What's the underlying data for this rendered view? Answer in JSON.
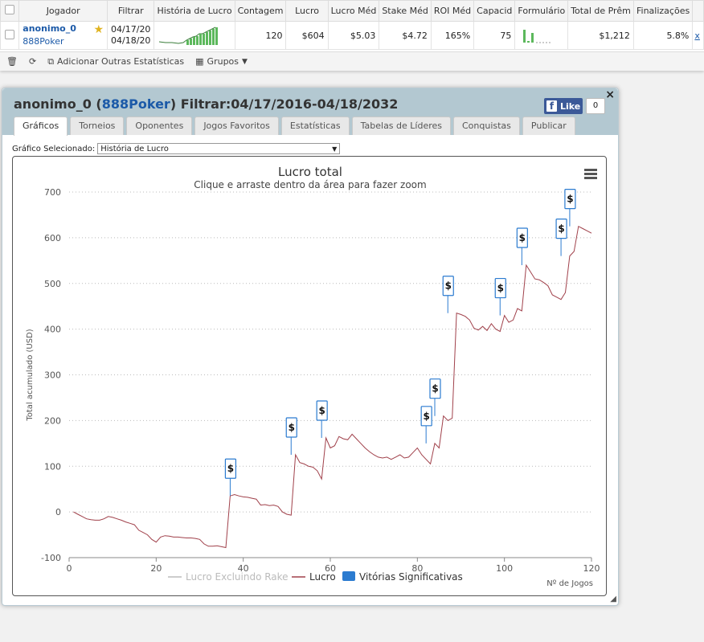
{
  "stats": {
    "columns": [
      "Jogador",
      "Filtrar",
      "História de Lucro",
      "Contagem",
      "Lucro",
      "Lucro Méd",
      "Stake Méd",
      "ROI Méd",
      "Capacid",
      "Formulário",
      "Total de Prêm",
      "Finalizações"
    ],
    "row": {
      "player": "anonimo_0",
      "site": "888Poker",
      "filter_from": "04/17/20",
      "filter_to": "04/18/20",
      "count": "120",
      "profit": "$604",
      "avg_profit": "$5.03",
      "avg_stake": "$4.72",
      "avg_roi": "165%",
      "ability": "75",
      "total_prizes": "$1,212",
      "finishes": "5.8%",
      "remove": "x"
    },
    "toolbar": {
      "add_stats": "Adicionar Outras Estatísticas",
      "groups": "Grupos"
    }
  },
  "panel": {
    "player": "anonimo_0",
    "site": "888Poker",
    "filter_label": "Filtrar:",
    "filter_range": "04/17/2016-04/18/2032",
    "fb_like": "Like",
    "fb_count": "0",
    "close": "×",
    "tabs": [
      "Gráficos",
      "Torneios",
      "Oponentes",
      "Jogos Favoritos",
      "Estatísticas",
      "Tabelas de Líderes",
      "Conquistas",
      "Publicar"
    ],
    "selected_label": "Gráfico Selecionado:",
    "selected_value": "História de Lucro"
  },
  "chart_data": {
    "type": "line",
    "title": "Lucro total",
    "subtitle": "Clique e arraste dentro da área para fazer zoom",
    "ylabel": "Total acumulado (USD)",
    "xlabel": "Nº de Jogos",
    "xlim": [
      0,
      120
    ],
    "ylim": [
      -100,
      700
    ],
    "xticks": [
      0,
      20,
      40,
      60,
      80,
      100,
      120
    ],
    "yticks": [
      -100,
      0,
      100,
      200,
      300,
      400,
      500,
      600,
      700
    ],
    "legend": [
      "Lucro Excluindo Rake",
      "Lucro",
      "Vitórias Significativas"
    ],
    "colors": {
      "line": "#a0404a",
      "rake": "#cccccc",
      "flag": "#2b7bd0"
    },
    "series": [
      {
        "name": "Lucro",
        "x": [
          1,
          2,
          3,
          4,
          5,
          6,
          7,
          8,
          9,
          10,
          11,
          12,
          13,
          14,
          15,
          16,
          17,
          18,
          19,
          20,
          21,
          22,
          23,
          24,
          25,
          26,
          27,
          28,
          29,
          30,
          31,
          32,
          33,
          34,
          35,
          36,
          37,
          38,
          39,
          40,
          41,
          42,
          43,
          44,
          45,
          46,
          47,
          48,
          49,
          50,
          51,
          52,
          53,
          54,
          55,
          56,
          57,
          58,
          59,
          60,
          61,
          62,
          63,
          64,
          65,
          66,
          67,
          68,
          69,
          70,
          71,
          72,
          73,
          74,
          75,
          76,
          77,
          78,
          79,
          80,
          81,
          82,
          83,
          84,
          85,
          86,
          87,
          88,
          89,
          90,
          91,
          92,
          93,
          94,
          95,
          96,
          97,
          98,
          99,
          100,
          101,
          102,
          103,
          104,
          105,
          106,
          107,
          108,
          109,
          110,
          111,
          112,
          113,
          114,
          115,
          116,
          117,
          118,
          119,
          120
        ],
        "values": [
          0,
          -5,
          -10,
          -15,
          -17,
          -18,
          -18,
          -15,
          -10,
          -12,
          -15,
          -18,
          -22,
          -25,
          -28,
          -40,
          -45,
          -50,
          -60,
          -66,
          -55,
          -52,
          -53,
          -55,
          -55,
          -56,
          -57,
          -57,
          -58,
          -60,
          -70,
          -75,
          -75,
          -74,
          -76,
          -78,
          35,
          38,
          35,
          33,
          32,
          30,
          28,
          15,
          16,
          14,
          15,
          12,
          0,
          -5,
          -7,
          125,
          108,
          105,
          100,
          98,
          90,
          72,
          162,
          140,
          145,
          165,
          160,
          158,
          170,
          160,
          150,
          140,
          132,
          125,
          120,
          118,
          120,
          115,
          120,
          125,
          118,
          120,
          130,
          140,
          125,
          115,
          105,
          150,
          140,
          210,
          200,
          205,
          435,
          432,
          428,
          420,
          402,
          398,
          406,
          397,
          412,
          400,
          395,
          430,
          415,
          420,
          445,
          440,
          540,
          525,
          510,
          508,
          502,
          495,
          475,
          470,
          465,
          480,
          560,
          570,
          625,
          620,
          615,
          610
        ]
      }
    ],
    "flags": [
      {
        "x": 37,
        "y": 35,
        "label": "$"
      },
      {
        "x": 51,
        "y": 125,
        "label": "$"
      },
      {
        "x": 58,
        "y": 162,
        "label": "$"
      },
      {
        "x": 82,
        "y": 150,
        "label": "$"
      },
      {
        "x": 84,
        "y": 210,
        "label": "$"
      },
      {
        "x": 87,
        "y": 435,
        "label": "$"
      },
      {
        "x": 99,
        "y": 430,
        "label": "$"
      },
      {
        "x": 104,
        "y": 540,
        "label": "$"
      },
      {
        "x": 113,
        "y": 560,
        "label": "$"
      },
      {
        "x": 115,
        "y": 625,
        "label": "$"
      }
    ]
  }
}
